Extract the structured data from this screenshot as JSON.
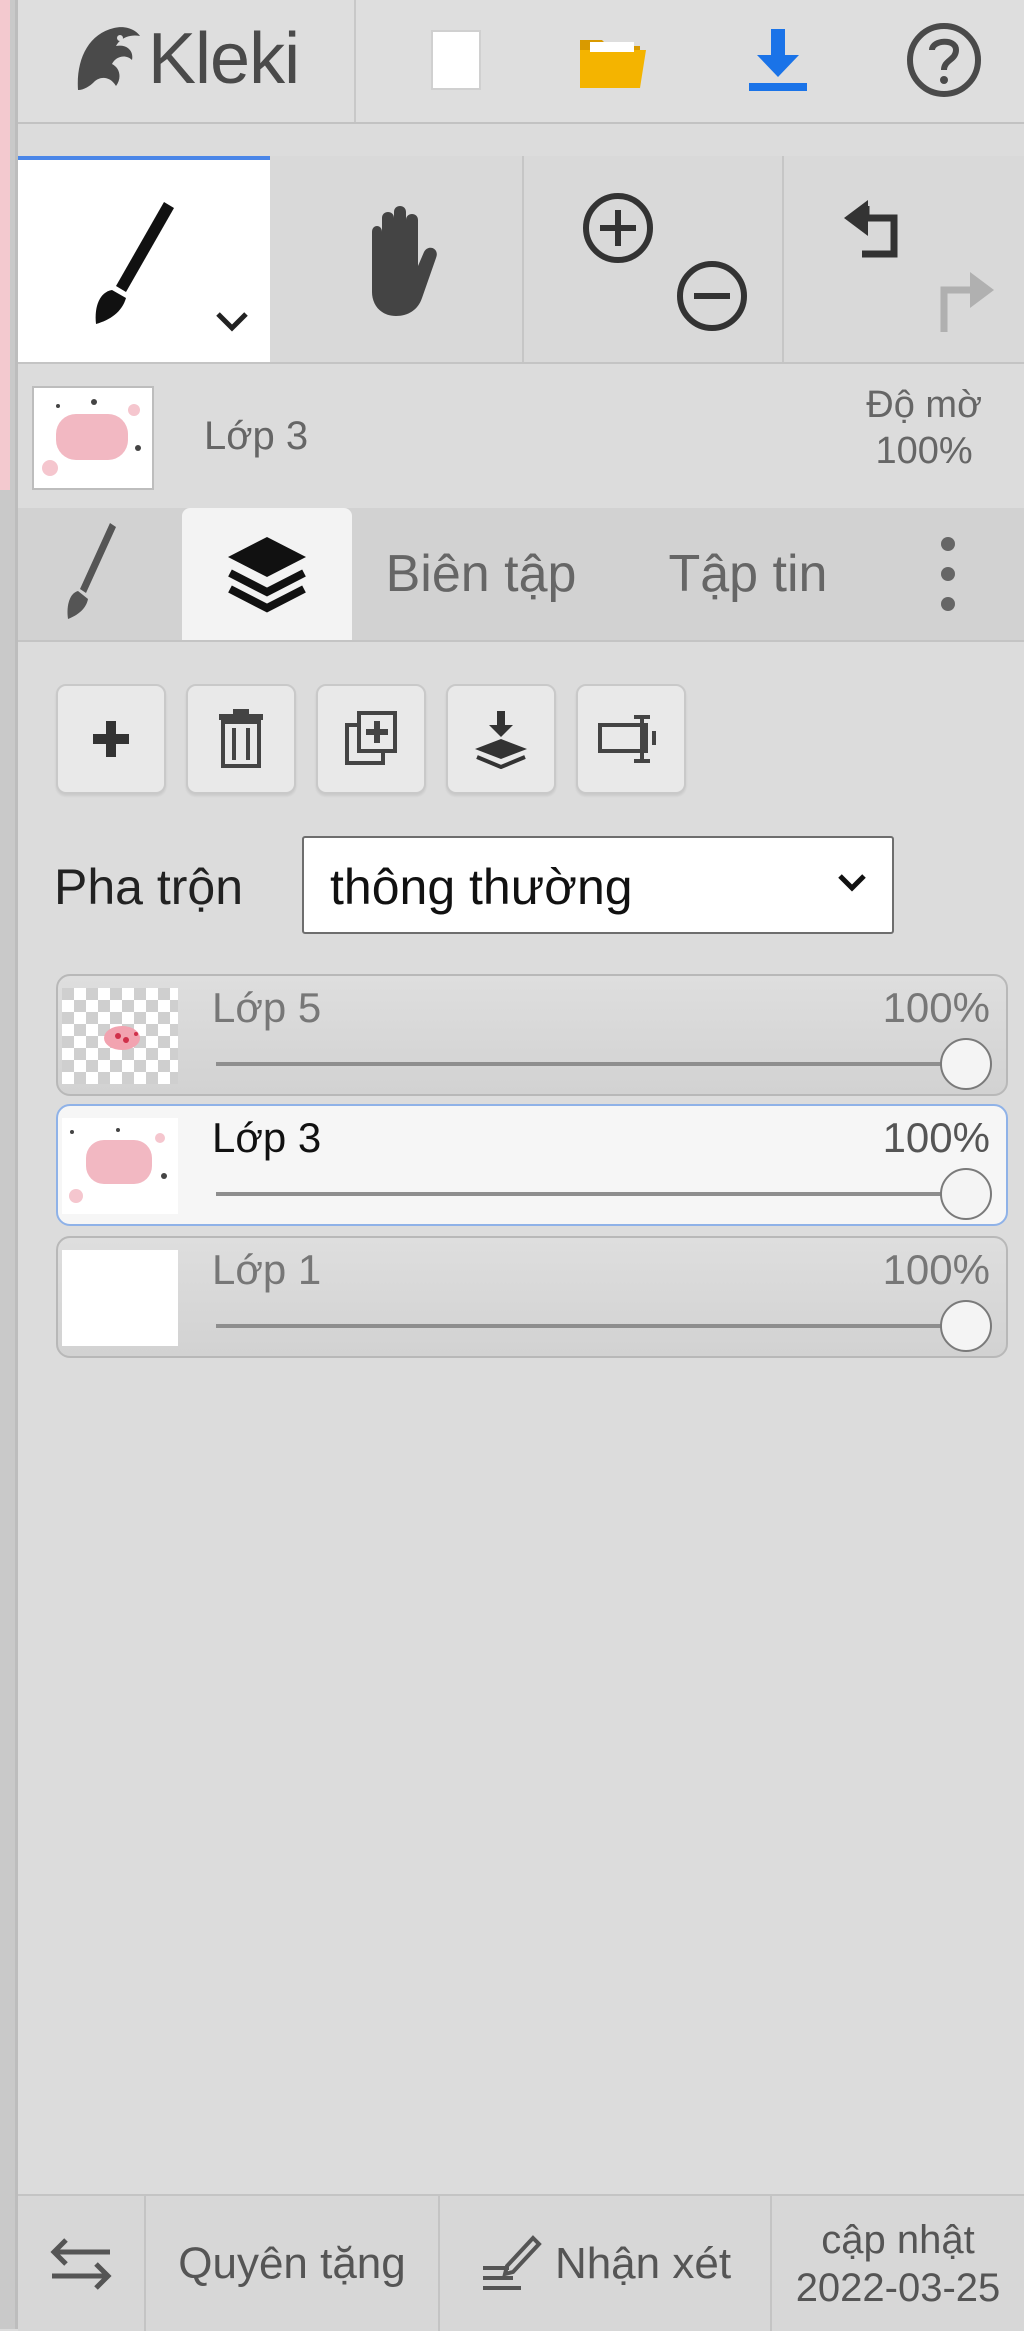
{
  "app": {
    "name": "Kleki"
  },
  "layer_info": {
    "current_layer": "Lớp 3",
    "opacity_label": "Độ mờ",
    "opacity_value": "100%"
  },
  "tabs": [
    {
      "label": "Biên tập"
    },
    {
      "label": "Tập tin"
    }
  ],
  "blend": {
    "label": "Pha trộn",
    "value": "thông thường"
  },
  "layers": [
    {
      "name": "Lớp 5",
      "opacity": "100%",
      "opacity_fraction": 1.0,
      "active": false
    },
    {
      "name": "Lớp 3",
      "opacity": "100%",
      "opacity_fraction": 1.0,
      "active": true
    },
    {
      "name": "Lớp 1",
      "opacity": "100%",
      "opacity_fraction": 1.0,
      "active": false
    }
  ],
  "bottom": {
    "donate_label": "Quyên tặng",
    "feedback_label": "Nhận xét",
    "update_label": "cập nhật",
    "update_date": "2022-03-25"
  },
  "icons": {
    "new": "new-image-icon",
    "open": "folder-open-icon",
    "save": "download-icon",
    "help": "help-icon",
    "brush": "brush-icon",
    "hand": "hand-icon",
    "zoom_in": "zoom-in-icon",
    "zoom_out": "zoom-out-icon",
    "undo": "undo-icon",
    "redo": "redo-icon",
    "layers": "layers-icon",
    "more": "more-vertical-icon",
    "add_layer": "plus-icon",
    "delete_layer": "trash-icon",
    "duplicate_layer": "duplicate-icon",
    "merge_down": "merge-down-icon",
    "rename_layer": "rename-icon",
    "swap_side": "swap-icon",
    "feedback": "feedback-icon"
  },
  "colors": {
    "accent": "#4a86e8",
    "save_blue": "#1a73e8",
    "folder_yellow": "#f4b400"
  }
}
